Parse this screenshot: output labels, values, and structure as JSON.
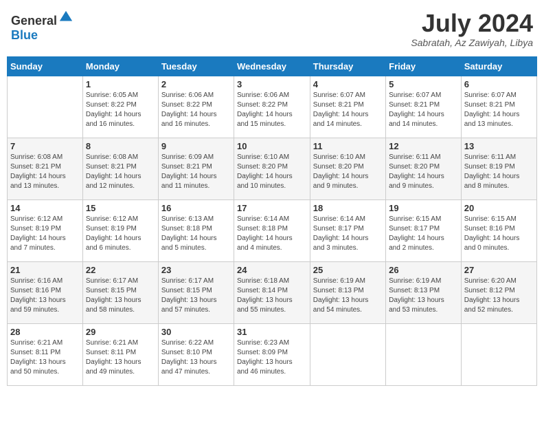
{
  "logo": {
    "text_general": "General",
    "text_blue": "Blue"
  },
  "title": {
    "month_year": "July 2024",
    "location": "Sabratah, Az Zawiyah, Libya"
  },
  "days_of_week": [
    "Sunday",
    "Monday",
    "Tuesday",
    "Wednesday",
    "Thursday",
    "Friday",
    "Saturday"
  ],
  "weeks": [
    [
      {
        "day": "",
        "info": ""
      },
      {
        "day": "1",
        "info": "Sunrise: 6:05 AM\nSunset: 8:22 PM\nDaylight: 14 hours\nand 16 minutes."
      },
      {
        "day": "2",
        "info": "Sunrise: 6:06 AM\nSunset: 8:22 PM\nDaylight: 14 hours\nand 16 minutes."
      },
      {
        "day": "3",
        "info": "Sunrise: 6:06 AM\nSunset: 8:22 PM\nDaylight: 14 hours\nand 15 minutes."
      },
      {
        "day": "4",
        "info": "Sunrise: 6:07 AM\nSunset: 8:21 PM\nDaylight: 14 hours\nand 14 minutes."
      },
      {
        "day": "5",
        "info": "Sunrise: 6:07 AM\nSunset: 8:21 PM\nDaylight: 14 hours\nand 14 minutes."
      },
      {
        "day": "6",
        "info": "Sunrise: 6:07 AM\nSunset: 8:21 PM\nDaylight: 14 hours\nand 13 minutes."
      }
    ],
    [
      {
        "day": "7",
        "info": "Sunrise: 6:08 AM\nSunset: 8:21 PM\nDaylight: 14 hours\nand 13 minutes."
      },
      {
        "day": "8",
        "info": "Sunrise: 6:08 AM\nSunset: 8:21 PM\nDaylight: 14 hours\nand 12 minutes."
      },
      {
        "day": "9",
        "info": "Sunrise: 6:09 AM\nSunset: 8:21 PM\nDaylight: 14 hours\nand 11 minutes."
      },
      {
        "day": "10",
        "info": "Sunrise: 6:10 AM\nSunset: 8:20 PM\nDaylight: 14 hours\nand 10 minutes."
      },
      {
        "day": "11",
        "info": "Sunrise: 6:10 AM\nSunset: 8:20 PM\nDaylight: 14 hours\nand 9 minutes."
      },
      {
        "day": "12",
        "info": "Sunrise: 6:11 AM\nSunset: 8:20 PM\nDaylight: 14 hours\nand 9 minutes."
      },
      {
        "day": "13",
        "info": "Sunrise: 6:11 AM\nSunset: 8:19 PM\nDaylight: 14 hours\nand 8 minutes."
      }
    ],
    [
      {
        "day": "14",
        "info": "Sunrise: 6:12 AM\nSunset: 8:19 PM\nDaylight: 14 hours\nand 7 minutes."
      },
      {
        "day": "15",
        "info": "Sunrise: 6:12 AM\nSunset: 8:19 PM\nDaylight: 14 hours\nand 6 minutes."
      },
      {
        "day": "16",
        "info": "Sunrise: 6:13 AM\nSunset: 8:18 PM\nDaylight: 14 hours\nand 5 minutes."
      },
      {
        "day": "17",
        "info": "Sunrise: 6:14 AM\nSunset: 8:18 PM\nDaylight: 14 hours\nand 4 minutes."
      },
      {
        "day": "18",
        "info": "Sunrise: 6:14 AM\nSunset: 8:17 PM\nDaylight: 14 hours\nand 3 minutes."
      },
      {
        "day": "19",
        "info": "Sunrise: 6:15 AM\nSunset: 8:17 PM\nDaylight: 14 hours\nand 2 minutes."
      },
      {
        "day": "20",
        "info": "Sunrise: 6:15 AM\nSunset: 8:16 PM\nDaylight: 14 hours\nand 0 minutes."
      }
    ],
    [
      {
        "day": "21",
        "info": "Sunrise: 6:16 AM\nSunset: 8:16 PM\nDaylight: 13 hours\nand 59 minutes."
      },
      {
        "day": "22",
        "info": "Sunrise: 6:17 AM\nSunset: 8:15 PM\nDaylight: 13 hours\nand 58 minutes."
      },
      {
        "day": "23",
        "info": "Sunrise: 6:17 AM\nSunset: 8:15 PM\nDaylight: 13 hours\nand 57 minutes."
      },
      {
        "day": "24",
        "info": "Sunrise: 6:18 AM\nSunset: 8:14 PM\nDaylight: 13 hours\nand 55 minutes."
      },
      {
        "day": "25",
        "info": "Sunrise: 6:19 AM\nSunset: 8:13 PM\nDaylight: 13 hours\nand 54 minutes."
      },
      {
        "day": "26",
        "info": "Sunrise: 6:19 AM\nSunset: 8:13 PM\nDaylight: 13 hours\nand 53 minutes."
      },
      {
        "day": "27",
        "info": "Sunrise: 6:20 AM\nSunset: 8:12 PM\nDaylight: 13 hours\nand 52 minutes."
      }
    ],
    [
      {
        "day": "28",
        "info": "Sunrise: 6:21 AM\nSunset: 8:11 PM\nDaylight: 13 hours\nand 50 minutes."
      },
      {
        "day": "29",
        "info": "Sunrise: 6:21 AM\nSunset: 8:11 PM\nDaylight: 13 hours\nand 49 minutes."
      },
      {
        "day": "30",
        "info": "Sunrise: 6:22 AM\nSunset: 8:10 PM\nDaylight: 13 hours\nand 47 minutes."
      },
      {
        "day": "31",
        "info": "Sunrise: 6:23 AM\nSunset: 8:09 PM\nDaylight: 13 hours\nand 46 minutes."
      },
      {
        "day": "",
        "info": ""
      },
      {
        "day": "",
        "info": ""
      },
      {
        "day": "",
        "info": ""
      }
    ]
  ]
}
